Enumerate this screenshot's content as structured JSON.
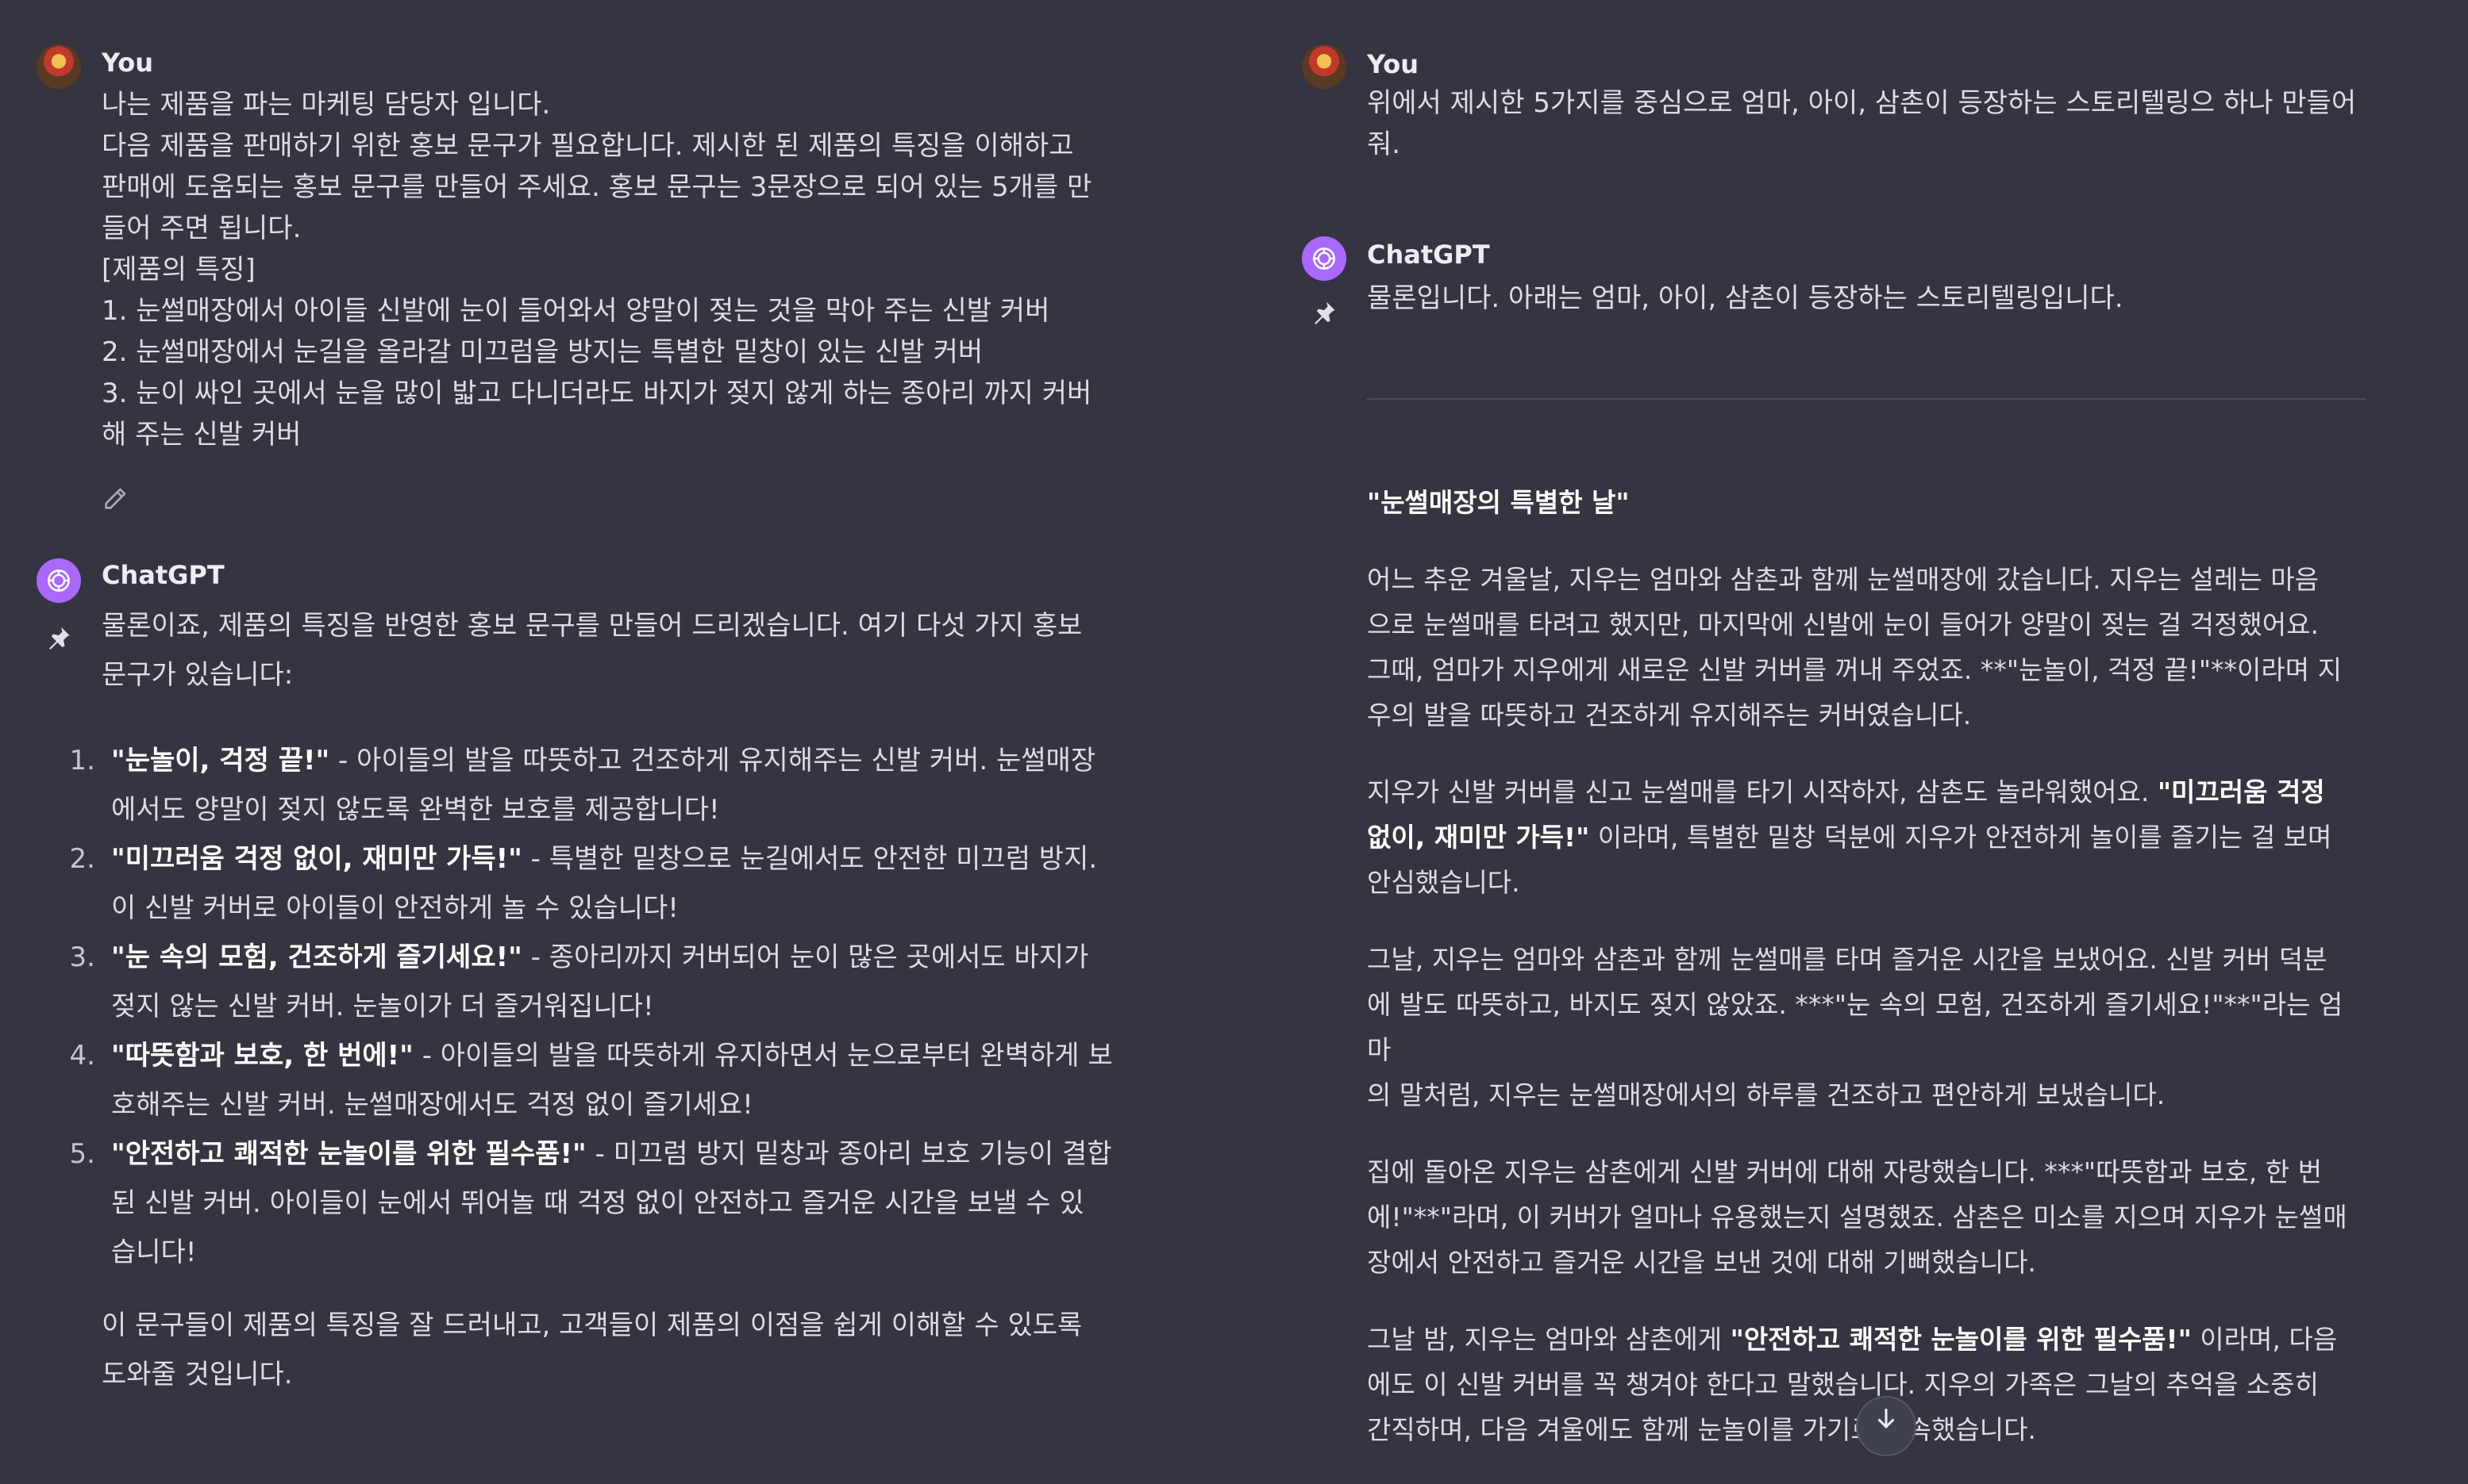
{
  "left": {
    "user": {
      "author": "You",
      "lines": [
        "나는 제품을 파는 마케팅 담당자 입니다.",
        "다음 제품을 판매하기 위한 홍보 문구가 필요합니다. 제시한 된 제품의 특징을 이해하고",
        "판매에 도움되는 홍보 문구를 만들어 주세요. 홍보 문구는 3문장으로 되어 있는 5개를 만",
        "들어 주면 됩니다.",
        "[제품의 특징]",
        "1. 눈썰매장에서 아이들 신발에 눈이 들어와서 양말이 젖는 것을 막아 주는 신발 커버",
        "2. 눈썰매장에서 눈길을 올라갈 미끄럼을 방지는 특별한 밑창이 있는 신발 커버",
        "3. 눈이 싸인 곳에서 눈을 많이 밟고 다니더라도 바지가 젖지 않게 하는 종아리 까지 커버",
        "해 주는 신발 커버"
      ]
    },
    "assistant": {
      "author": "ChatGPT",
      "intro_lines": [
        "물론이죠, 제품의 특징을 반영한 홍보 문구를 만들어 드리겠습니다. 여기 다섯 가지 홍보",
        "문구가 있습니다:"
      ],
      "items": [
        {
          "num": "1.",
          "title": "\"눈놀이, 걱정 끝!\"",
          "line1": " - 아이들의 발을 따뜻하고 건조하게 유지해주는 신발 커버. 눈썰매장",
          "line2": "에서도 양말이 젖지 않도록 완벽한 보호를 제공합니다!"
        },
        {
          "num": "2.",
          "title": "\"미끄러움 걱정 없이, 재미만 가득!\"",
          "line1": " - 특별한 밑창으로 눈길에서도 안전한 미끄럼 방지.",
          "line2": "이 신발 커버로 아이들이 안전하게 놀 수 있습니다!"
        },
        {
          "num": "3.",
          "title": "\"눈 속의 모험, 건조하게 즐기세요!\"",
          "line1": " - 종아리까지 커버되어 눈이 많은 곳에서도 바지가",
          "line2": "젖지 않는 신발 커버. 눈놀이가 더 즐거워집니다!"
        },
        {
          "num": "4.",
          "title": "\"따뜻함과 보호, 한 번에!\"",
          "line1": " - 아이들의 발을 따뜻하게 유지하면서 눈으로부터 완벽하게 보",
          "line2": "호해주는 신발 커버. 눈썰매장에서도 걱정 없이 즐기세요!"
        },
        {
          "num": "5.",
          "title": "\"안전하고 쾌적한 눈놀이를 위한 필수품!\"",
          "line1": " - 미끄럼 방지 밑창과 종아리 보호 기능이 결합",
          "line2": "된 신발 커버. 아이들이 눈에서 뛰어놀 때 걱정 없이 안전하고 즐거운 시간을 보낼 수 있",
          "line3": "습니다!"
        }
      ],
      "outro_lines": [
        "이 문구들이 제품의 특징을 잘 드러내고, 고객들이 제품의 이점을 쉽게 이해할 수 있도록",
        "도와줄 것입니다."
      ]
    }
  },
  "right": {
    "user": {
      "author": "You",
      "lines": [
        "위에서 제시한 5가지를 중심으로 엄마, 아이, 삼촌이 등장하는 스토리텔링으 하나 만들어",
        "줘."
      ]
    },
    "assistant": {
      "author": "ChatGPT",
      "intro": "물론입니다. 아래는 엄마, 아이, 삼촌이 등장하는 스토리텔링입니다.",
      "story_title": "\"눈썰매장의 특별한 날\"",
      "p1": {
        "lines": [
          "어느 추운 겨울날, 지우는 엄마와 삼촌과 함께 눈썰매장에 갔습니다. 지우는 설레는 마음",
          "으로 눈썰매를 타려고 했지만, 마지막에 신발에 눈이 들어가 양말이 젖는 걸 걱정했어요.",
          "그때, 엄마가 지우에게 새로운 신발 커버를 꺼내 주었죠. **\"눈놀이, 걱정 끝!\"**이라며 지",
          "우의 발을 따뜻하고 건조하게 유지해주는 커버였습니다."
        ]
      },
      "p2": {
        "l1a": "지우가 신발 커버를 신고 눈썰매를 타기 시작하자, 삼촌도 놀라워했어요. ",
        "l1b": "\"미끄러움 걱정",
        "l2a": "없이, 재미만 가득!\"",
        "l2b": " 이라며, 특별한 밑창 덕분에 지우가 안전하게 놀이를 즐기는 걸 보며",
        "l3": "안심했습니다."
      },
      "p3": {
        "lines": [
          "그날, 지우는 엄마와 삼촌과 함께 눈썰매를 타며 즐거운 시간을 보냈어요. 신발 커버 덕분",
          "에 발도 따뜻하고, 바지도 젖지 않았죠. ***\"눈 속의 모험, 건조하게 즐기세요!\"**\"라는 엄마",
          "의 말처럼, 지우는 눈썰매장에서의 하루를 건조하고 편안하게 보냈습니다."
        ]
      },
      "p4": {
        "lines": [
          "집에 돌아온 지우는 삼촌에게 신발 커버에 대해 자랑했습니다. ***\"따뜻함과 보호, 한 번",
          "에!\"**\"라며, 이 커버가 얼마나 유용했는지 설명했죠. 삼촌은 미소를 지으며 지우가 눈썰매",
          "장에서 안전하고 즐거운 시간을 보낸 것에 대해 기뻐했습니다."
        ]
      },
      "p5": {
        "l1a": "그날 밤, 지우는 엄마와 삼촌에게 ",
        "l1b": "\"안전하고 쾌적한 눈놀이를 위한 필수품!\"",
        "l1c": " 이라며, 다음",
        "l2": "에도 이 신발 커버를 꼭 챙겨야 한다고 말했습니다. 지우의 가족은 그날의 추억을 소중히",
        "l3": "간직하며, 다음 겨울에도 함께 눈놀이를 가기로 약속했습니다."
      }
    }
  },
  "icons": {
    "edit": "pencil-icon",
    "pin": "pin-icon",
    "scroll": "arrow-down-icon",
    "gpt": "openai-logo-icon"
  },
  "colors": {
    "background": "#343541",
    "gpt_avatar": "#ab68ff",
    "text": "#dcdce2"
  }
}
